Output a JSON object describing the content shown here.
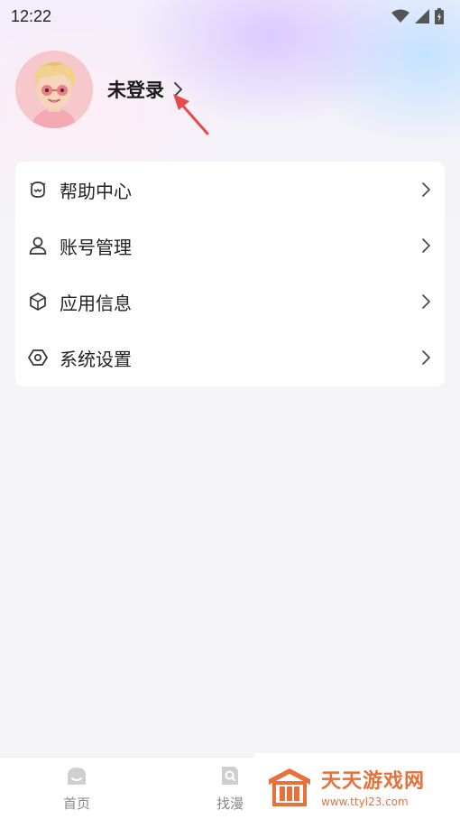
{
  "status_bar": {
    "time": "12:22"
  },
  "profile": {
    "name": "未登录"
  },
  "menu": {
    "items": [
      {
        "label": "帮助中心",
        "icon": "help-center-icon"
      },
      {
        "label": "账号管理",
        "icon": "user-icon"
      },
      {
        "label": "应用信息",
        "icon": "cube-icon"
      },
      {
        "label": "系统设置",
        "icon": "settings-hexagon-icon"
      }
    ]
  },
  "tab_bar": {
    "tabs": [
      {
        "label": "首页",
        "icon": "home-icon"
      },
      {
        "label": "找漫",
        "icon": "search-doc-icon"
      }
    ]
  },
  "watermark": {
    "title": "天天游戏网",
    "url": "www.ttyl23.com"
  },
  "colors": {
    "annotation_arrow": "#e84a4a",
    "watermark_accent": "#e8703a"
  }
}
